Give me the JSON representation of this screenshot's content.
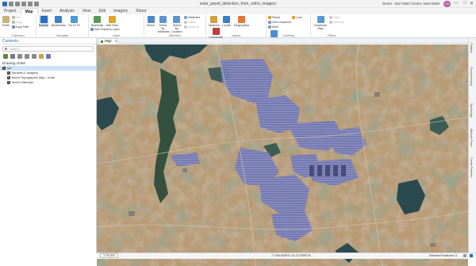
{
  "window": {
    "title": "solar_panel_detection_from_ortho_imagery",
    "account": "Demo - Esri R&D Center, New Delhi",
    "avatar": "DH",
    "minimize": "—",
    "maximize": "□",
    "close": "✕"
  },
  "ribbon_tabs": [
    {
      "label": "Project",
      "active": false
    },
    {
      "label": "Map",
      "active": true
    },
    {
      "label": "Insert",
      "active": false
    },
    {
      "label": "Analysis",
      "active": false
    },
    {
      "label": "View",
      "active": false
    },
    {
      "label": "Edit",
      "active": false
    },
    {
      "label": "Imagery",
      "active": false
    },
    {
      "label": "Share",
      "active": false
    }
  ],
  "ribbon": {
    "clipboard": {
      "label": "Clipboard",
      "paste": "Paste",
      "cut": "Cut",
      "copy": "Copy",
      "copy_path": "Copy Path"
    },
    "navigate": {
      "label": "Navigate",
      "explore": "Explore",
      "bookmarks": "Bookmarks",
      "go_to_xy": "Go To XY"
    },
    "layer": {
      "label": "Layer",
      "basemap": "Basemap",
      "add_data": "Add Data",
      "add_graphics_layer": "Add Graphics Layer"
    },
    "selection": {
      "label": "Selection",
      "select": "Select",
      "select_by_attributes": "Select By Attributes",
      "select_by_location": "Select By Location",
      "attributes": "Attributes",
      "clear": "Clear",
      "zoom_to": "Zoom To"
    },
    "inquiry": {
      "label": "Inquiry",
      "measure": "Measure",
      "locate": "Locate",
      "infographics": "Infographics",
      "coordinate_conversion": "Coordinate Conversion"
    },
    "labeling": {
      "label": "Labeling",
      "pause": "Pause",
      "lock": "Lock",
      "view_unplaced": "View Unplaced",
      "more": "More",
      "convert": "Convert"
    },
    "offline": {
      "label": "Offline",
      "download_map": "Download Map",
      "sync": "Sync",
      "remove": "Remove"
    }
  },
  "contents": {
    "title": "Contents",
    "search_placeholder": "Search",
    "drawing_order": "Drawing Order",
    "layers": [
      {
        "label": "QA",
        "level": 0,
        "checked": true,
        "selected": true
      },
      {
        "label": "Sentinel-2 Imagery",
        "level": 1,
        "checked": true,
        "selected": false
      },
      {
        "label": "World Topographic Map - India",
        "level": 1,
        "checked": true,
        "selected": false
      },
      {
        "label": "World Hillshade",
        "level": 1,
        "checked": true,
        "selected": false
      }
    ]
  },
  "map_view": {
    "tab_label": "Map",
    "scale": "1:75,000",
    "coordinates": "77.4915939°E 14.2779093°N",
    "selected_features": "Selected Features: 0"
  },
  "right_panes": [
    "Catalog",
    "Geoprocessing",
    "Symbology",
    "Attribute Pane",
    "Create Features"
  ],
  "colors": {
    "accent": "#2a6cc0",
    "selected_tab": "#ffffff",
    "tree_selection": "#cde3f7",
    "solar_panels": "#6f76b5",
    "water": "#2a4a50",
    "terrain": "#b89a74"
  }
}
